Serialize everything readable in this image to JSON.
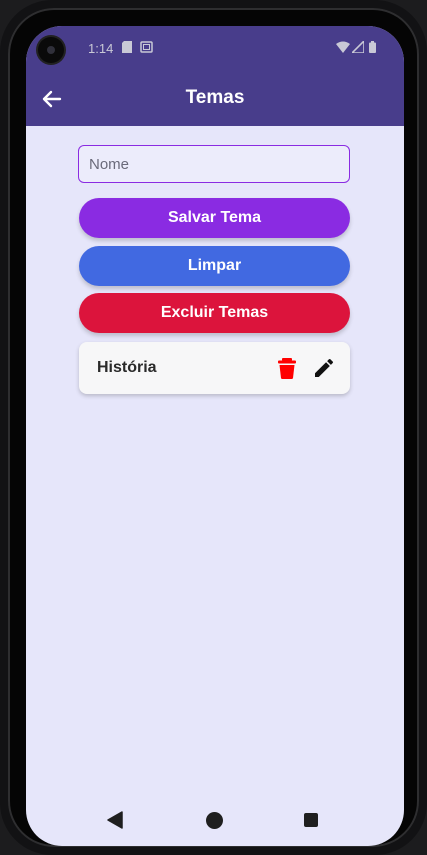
{
  "status_bar": {
    "time": "1:14",
    "icons": [
      "sd-card-icon",
      "screen-icon",
      "wifi-icon",
      "signal-icon",
      "battery-icon"
    ]
  },
  "app_bar": {
    "title": "Temas",
    "back_icon": "arrow-left-icon",
    "color": "#483d8b"
  },
  "form": {
    "name_placeholder": "Nome",
    "name_value": ""
  },
  "buttons": {
    "save_label": "Salvar Tema",
    "clear_label": "Limpar",
    "delete_all_label": "Excluir Temas",
    "save_color": "#8a2be2",
    "clear_color": "#4169e1",
    "delete_color": "#dc143c"
  },
  "themes": [
    {
      "name": "História",
      "delete_icon": "trash-icon",
      "edit_icon": "pencil-icon"
    }
  ],
  "nav_bar": {
    "icons": [
      "nav-back-icon",
      "nav-home-icon",
      "nav-recents-icon"
    ]
  },
  "colors": {
    "background": "#e6e6fa",
    "delete_icon": "#ff0000"
  }
}
